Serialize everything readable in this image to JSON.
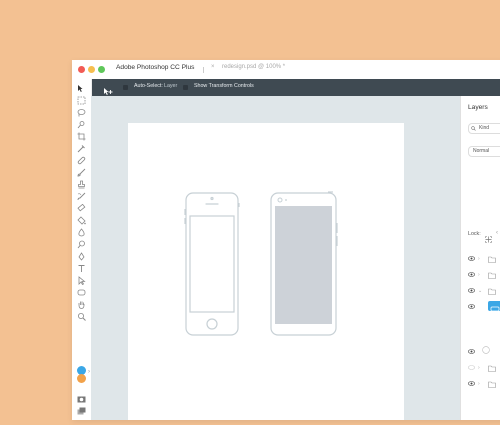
{
  "titlebar": {
    "app_title": "Adobe Photoshop CC Plus",
    "close_glyph": "×",
    "document_tab": "redesign.psd @ 100% *",
    "traffic_lights": [
      "#f25b55",
      "#f6be4f",
      "#5fc75a"
    ]
  },
  "options_bar": {
    "auto_select_label": "Auto-Select:",
    "auto_select_value": "Layer",
    "transform_controls_label": "Show Transform Controls"
  },
  "tools": [
    "marquee-icon",
    "lasso-icon",
    "quick-select-icon",
    "crop-icon",
    "eyedropper-icon",
    "healing-icon",
    "brush-icon",
    "stamp-icon",
    "history-brush-icon",
    "eraser-icon",
    "paint-bucket-icon",
    "blur-icon",
    "dodge-icon",
    "pen-icon",
    "type-icon",
    "path-select-icon",
    "shape-icon",
    "hand-icon",
    "zoom-icon"
  ],
  "colors": {
    "foreground": "#3ba7e6",
    "background": "#f2a24a",
    "accent": "#3ba7e6"
  },
  "layers_panel": {
    "title": "Layers",
    "filter_value": "Kind",
    "blend_mode": "Normal",
    "lock_label": "Lock:",
    "rows": [
      {
        "icon": "folder-icon"
      },
      {
        "icon": "folder-icon"
      },
      {
        "icon": "folder-icon"
      },
      {
        "icon": "layer-thumbnail-icon"
      },
      {
        "icon": "circle-thumbnail-icon"
      },
      {
        "icon": "folder-icon"
      },
      {
        "icon": "folder-icon"
      }
    ]
  }
}
